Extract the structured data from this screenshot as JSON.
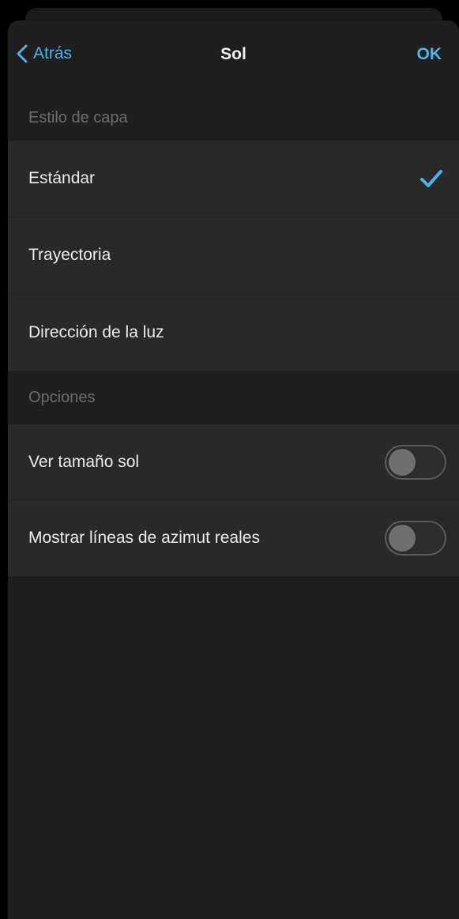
{
  "navbar": {
    "back_label": "Atrás",
    "title": "Sol",
    "ok_label": "OK"
  },
  "layer_style": {
    "header": "Estilo de capa",
    "items": [
      {
        "label": "Estándar",
        "selected": true
      },
      {
        "label": "Trayectoria",
        "selected": false
      },
      {
        "label": "Dirección de la luz",
        "selected": false
      }
    ]
  },
  "options": {
    "header": "Opciones",
    "items": [
      {
        "label": "Ver tamaño sol",
        "enabled": false
      },
      {
        "label": "Mostrar líneas de azimut reales",
        "enabled": false
      }
    ]
  },
  "colors": {
    "accent": "#4cb4ea",
    "background": "#1f1f1f",
    "row_background": "#292929"
  }
}
